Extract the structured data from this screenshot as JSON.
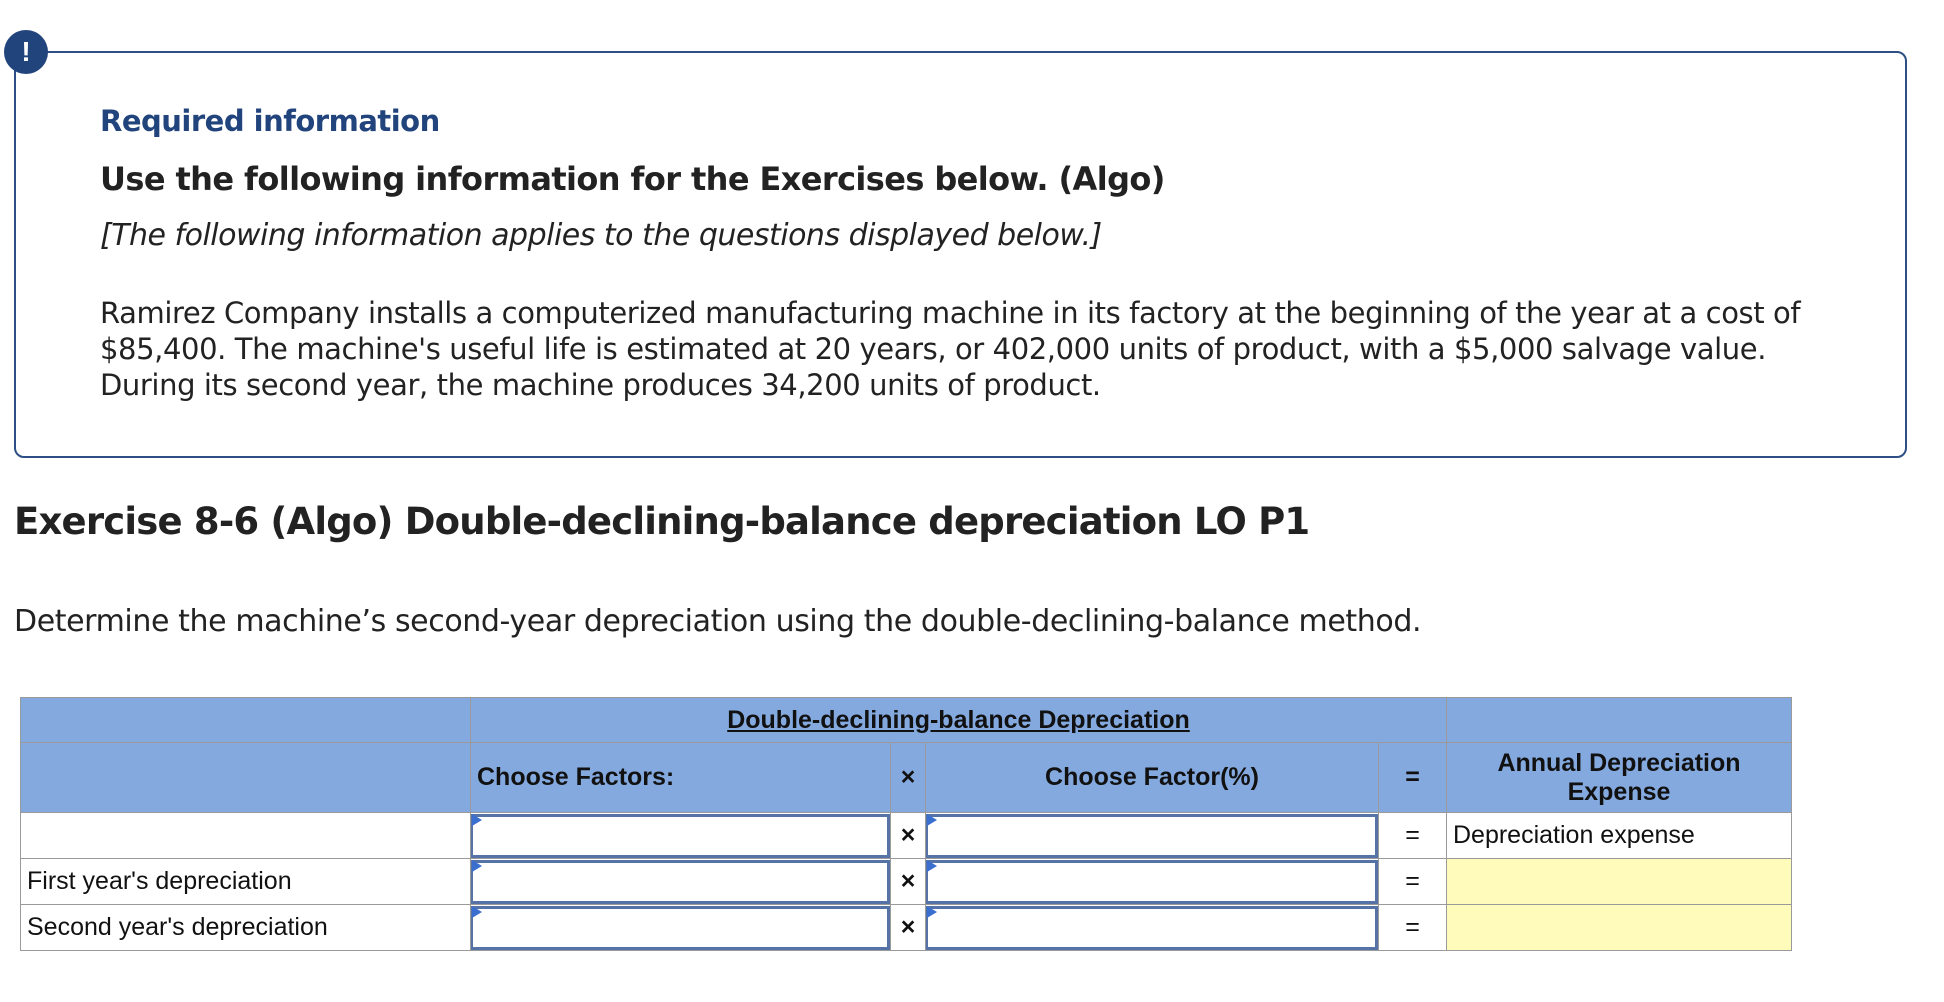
{
  "alert_icon": "exclamation-icon",
  "colors": {
    "accent": "#22447c",
    "table_header": "#84a9df",
    "answer_cell": "#fffbbb",
    "input_border": "#5673a8"
  },
  "info": {
    "required_label": "Required information",
    "heading": "Use the following information for the Exercises below. (Algo)",
    "applies_note": "[The following information applies to the questions displayed below.]",
    "scenario": "Ramirez Company installs a computerized manufacturing machine in its factory at the beginning of the year at a cost of $85,400. The machine's useful life is estimated at 20 years, or 402,000 units of product, with a $5,000 salvage value. During its second year, the machine produces 34,200 units of product."
  },
  "exercise": {
    "title": "Exercise 8-6 (Algo) Double-declining-balance depreciation LO P1",
    "instruction": "Determine the machine’s second-year depreciation using the double-declining-balance method."
  },
  "table": {
    "title": "Double-declining-balance Depreciation",
    "col_factors": "Choose Factors:",
    "col_multiply": "×",
    "col_factor_pct": "Choose Factor(%)",
    "col_equals": "=",
    "col_result": "Annual Depreciation Expense",
    "rows": [
      {
        "label": "",
        "factor": "",
        "multiply": "×",
        "factor_pct": "",
        "equals": "=",
        "result": "Depreciation expense"
      },
      {
        "label": "First year's depreciation",
        "factor": "",
        "multiply": "×",
        "factor_pct": "",
        "equals": "=",
        "result": ""
      },
      {
        "label": "Second year's depreciation",
        "factor": "",
        "multiply": "×",
        "factor_pct": "",
        "equals": "=",
        "result": ""
      }
    ]
  }
}
